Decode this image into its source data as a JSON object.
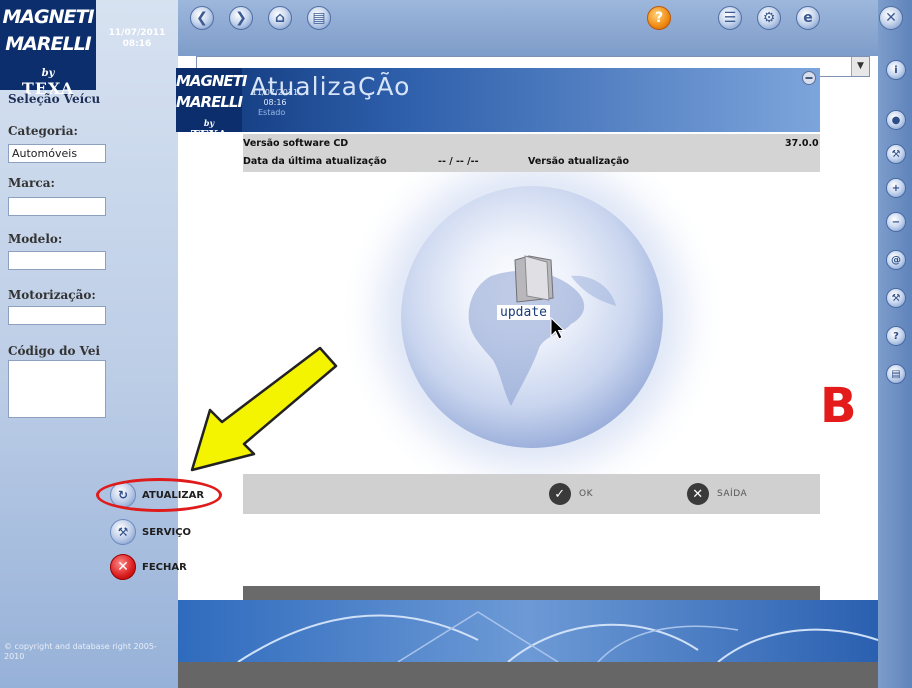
{
  "brand": {
    "line1": "MAGNETI",
    "line2": "MARELLI",
    "by": "by",
    "texa": "TEXA"
  },
  "datetime": {
    "date": "11/07/2011",
    "time": "08:16"
  },
  "toolbar": {
    "icons": [
      "back-icon",
      "forward-icon",
      "home-icon",
      "print-icon",
      "help-icon",
      "language-icon",
      "settings-icon",
      "internet-explorer-icon",
      "close-icon"
    ]
  },
  "sidebar": {
    "title": "Seleção Veícu",
    "category_label": "Categoria:",
    "category_value": "Automóveis",
    "brand_label": "Marca:",
    "brand_value": "",
    "model_label": "Modelo:",
    "model_value": "",
    "engine_label": "Motorização:",
    "engine_value": "",
    "vehicle_code_label": "Código do Vei",
    "copyright": "© copyright and database right 2005-2010"
  },
  "actions": {
    "update": "ATUALIZAR",
    "service": "SERVIÇO",
    "close": "FECHAR"
  },
  "dialog": {
    "title": "AtualizaÇÃo",
    "subtitle": "Estado",
    "cd_version_label": "Versão software CD",
    "cd_version_value": "37.0.0",
    "last_update_label": "Data da última atualização",
    "last_update_value": "-- / -- /--",
    "update_version_label": "Versão atualização",
    "update_version_value": "",
    "update_icon_label": "update",
    "ok": "OK",
    "exit": "SAÍDA"
  },
  "colors": {
    "brand_navy": "#0c2e6c",
    "highlight_red": "#e01b1b",
    "arrow_yellow": "#f4f400"
  }
}
